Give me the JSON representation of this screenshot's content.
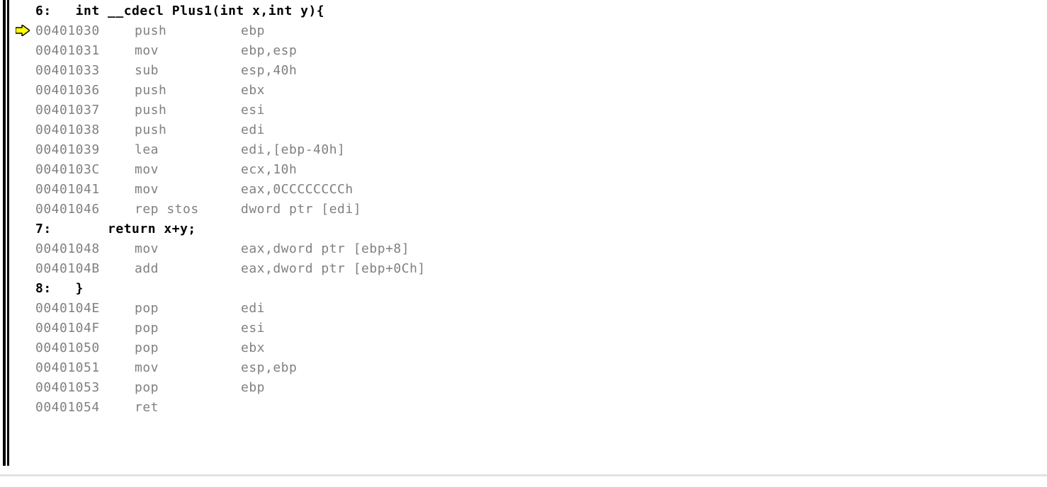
{
  "lines": [
    {
      "kind": "src",
      "arrow": false,
      "line_no": "6:",
      "text": "   int __cdecl Plus1(int x,int y){"
    },
    {
      "kind": "asm",
      "arrow": true,
      "addr": "00401030",
      "mnem": "push",
      "ops": "ebp"
    },
    {
      "kind": "asm",
      "arrow": false,
      "addr": "00401031",
      "mnem": "mov",
      "ops": "ebp,esp"
    },
    {
      "kind": "asm",
      "arrow": false,
      "addr": "00401033",
      "mnem": "sub",
      "ops": "esp,40h"
    },
    {
      "kind": "asm",
      "arrow": false,
      "addr": "00401036",
      "mnem": "push",
      "ops": "ebx"
    },
    {
      "kind": "asm",
      "arrow": false,
      "addr": "00401037",
      "mnem": "push",
      "ops": "esi"
    },
    {
      "kind": "asm",
      "arrow": false,
      "addr": "00401038",
      "mnem": "push",
      "ops": "edi"
    },
    {
      "kind": "asm",
      "arrow": false,
      "addr": "00401039",
      "mnem": "lea",
      "ops": "edi,[ebp-40h]"
    },
    {
      "kind": "asm",
      "arrow": false,
      "addr": "0040103C",
      "mnem": "mov",
      "ops": "ecx,10h"
    },
    {
      "kind": "asm",
      "arrow": false,
      "addr": "00401041",
      "mnem": "mov",
      "ops": "eax,0CCCCCCCCh"
    },
    {
      "kind": "asm",
      "arrow": false,
      "addr": "00401046",
      "mnem": "rep stos",
      "ops": "dword ptr [edi]"
    },
    {
      "kind": "src",
      "arrow": false,
      "line_no": "7:",
      "text": "       return x+y;"
    },
    {
      "kind": "asm",
      "arrow": false,
      "addr": "00401048",
      "mnem": "mov",
      "ops": "eax,dword ptr [ebp+8]"
    },
    {
      "kind": "asm",
      "arrow": false,
      "addr": "0040104B",
      "mnem": "add",
      "ops": "eax,dword ptr [ebp+0Ch]"
    },
    {
      "kind": "src",
      "arrow": false,
      "line_no": "8:",
      "text": "   }"
    },
    {
      "kind": "asm",
      "arrow": false,
      "addr": "0040104E",
      "mnem": "pop",
      "ops": "edi"
    },
    {
      "kind": "asm",
      "arrow": false,
      "addr": "0040104F",
      "mnem": "pop",
      "ops": "esi"
    },
    {
      "kind": "asm",
      "arrow": false,
      "addr": "00401050",
      "mnem": "pop",
      "ops": "ebx"
    },
    {
      "kind": "asm",
      "arrow": false,
      "addr": "00401051",
      "mnem": "mov",
      "ops": "esp,ebp"
    },
    {
      "kind": "asm",
      "arrow": false,
      "addr": "00401053",
      "mnem": "pop",
      "ops": "ebp"
    },
    {
      "kind": "asm",
      "arrow": false,
      "addr": "00401054",
      "mnem": "ret",
      "ops": ""
    }
  ],
  "arrow_svg_title": "current-instruction-arrow"
}
